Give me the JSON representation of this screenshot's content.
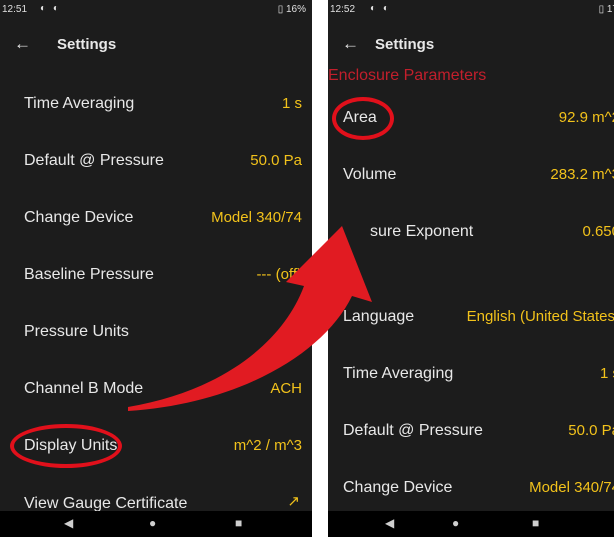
{
  "left_screen": {
    "status": {
      "time": "12:51",
      "notif_icons": "◐ ◐",
      "battery": "▯ 16%"
    },
    "appbar": {
      "back": "←",
      "title": "Settings"
    },
    "rows": [
      {
        "label": "Time Averaging",
        "value": "1 s"
      },
      {
        "label": "Default @ Pressure",
        "value": "50.0 Pa"
      },
      {
        "label": "Change Device",
        "value": "Model 340/74"
      },
      {
        "label": "Baseline Pressure",
        "value": "--- (off)"
      },
      {
        "label": "Pressure Units",
        "value": "P"
      },
      {
        "label": "Channel B Mode",
        "value": "ACH"
      },
      {
        "label": "Display Units",
        "value": "m^2 / m^3"
      },
      {
        "label": "View Gauge Certificate",
        "value": "↗"
      }
    ],
    "nav": {
      "back": "◀",
      "home": "●",
      "recents": "■"
    }
  },
  "right_screen": {
    "status": {
      "time": "12:52",
      "notif_icons": "◐ ◐",
      "battery": "▯ 17"
    },
    "appbar": {
      "back": "←",
      "title": "Settings"
    },
    "section_enclosure": "Enclosure Parameters",
    "section_gauge": "uge",
    "rows": [
      {
        "label": "Area",
        "value": "92.9 m^2"
      },
      {
        "label": "Volume",
        "value": "283.2 m^3"
      },
      {
        "label": "sure Exponent",
        "value": "0.650"
      },
      {
        "label": "Language",
        "value": "English (United States)"
      },
      {
        "label": "Time Averaging",
        "value": "1 s"
      },
      {
        "label": "Default @ Pressure",
        "value": "50.0 Pa"
      },
      {
        "label": "Change Device",
        "value": "Model 340/74"
      }
    ],
    "nav": {
      "back": "◀",
      "home": "●",
      "recents": "■"
    }
  },
  "colors": {
    "background": "#1c1c1c",
    "value": "#f2c21b",
    "section": "#c21f2c",
    "highlight": "#e1101b",
    "arrow": "#e11b22"
  },
  "icons": [
    "arrow-left-icon",
    "open-external-icon",
    "nav-back-icon",
    "nav-home-icon",
    "nav-recents-icon",
    "notification-icon",
    "battery-icon"
  ]
}
